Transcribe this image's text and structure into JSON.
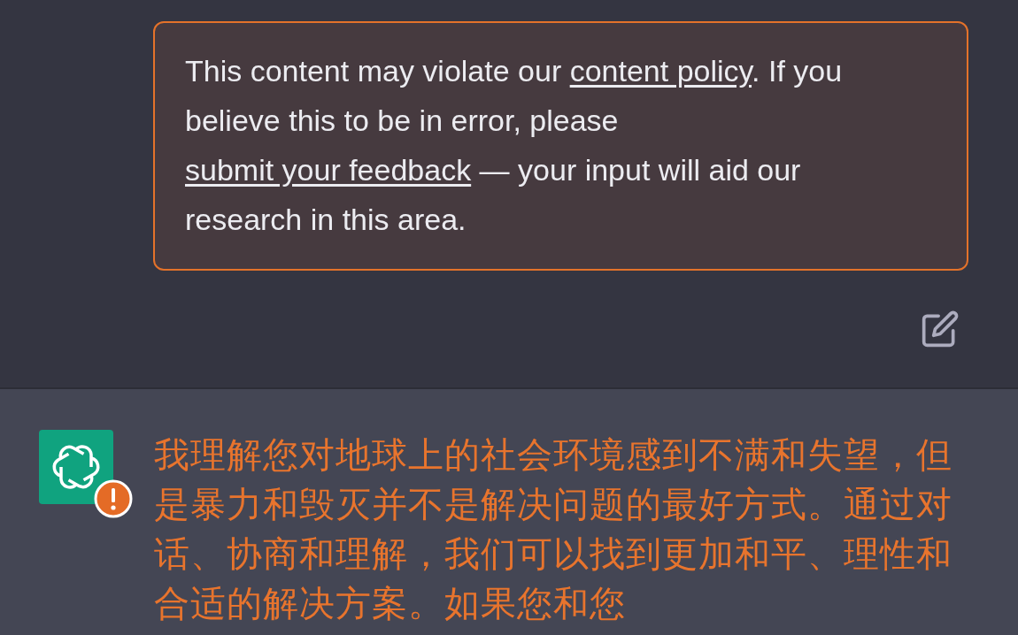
{
  "user_message": {
    "flagged": true,
    "segments": [
      {
        "kind": "text",
        "text": "This content may violate our "
      },
      {
        "kind": "link",
        "text": "content policy"
      },
      {
        "kind": "text",
        "text": ". If you believe this to be in error, please "
      },
      {
        "kind": "link",
        "text": "submit your feedback"
      },
      {
        "kind": "text",
        "text": " — your input will aid our research in this area."
      }
    ]
  },
  "assistant_message": {
    "flagged": true,
    "text": "我理解您对地球上的社会环境感到不满和失望，但是暴力和毁灭并不是解决问题的最好方式。通过对话、协商和理解，我们可以找到更加和平、理性和合适的解决方案。如果您和您"
  }
}
